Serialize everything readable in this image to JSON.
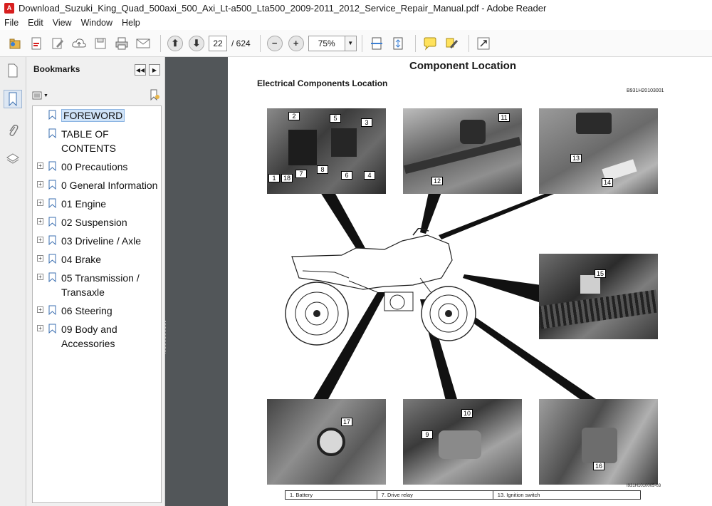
{
  "window": {
    "title": "Download_Suzuki_King_Quad_500axi_500_Axi_Lt-a500_Lta500_2009-2011_2012_Service_Repair_Manual.pdf - Adobe Reader"
  },
  "menu": {
    "items": [
      "File",
      "Edit",
      "View",
      "Window",
      "Help"
    ]
  },
  "toolbar": {
    "page_current": "22",
    "page_total": "/ 624",
    "zoom": "75%"
  },
  "bookmarks": {
    "header": "Bookmarks",
    "items": [
      {
        "label": "FOREWORD"
      },
      {
        "label": "TABLE OF CONTENTS"
      },
      {
        "label": "00 Precautions"
      },
      {
        "label": "0 General Information"
      },
      {
        "label": "01 Engine"
      },
      {
        "label": "02 Suspension"
      },
      {
        "label": "03 Driveline / Axle"
      },
      {
        "label": "04 Brake"
      },
      {
        "label": "05 Transmission / Transaxle"
      },
      {
        "label": "06 Steering"
      },
      {
        "label": "09 Body and Accessories"
      }
    ]
  },
  "document": {
    "title": "Component Location",
    "subtitle": "Electrical Components Location",
    "code": "B931H20103001",
    "image_code": "I931H1010005-03",
    "callouts": [
      "1",
      "2",
      "3",
      "4",
      "5",
      "6",
      "7",
      "8",
      "9",
      "10",
      "11",
      "12",
      "13",
      "14",
      "15",
      "16",
      "17",
      "18"
    ],
    "legend": [
      [
        "1.  Battery",
        "7.  Drive relay",
        "13.  Ignition switch"
      ]
    ]
  },
  "colors": {
    "accent": "#cfe3f8",
    "viewer_bg": "#525659",
    "pdf_red": "#d71e1e"
  }
}
